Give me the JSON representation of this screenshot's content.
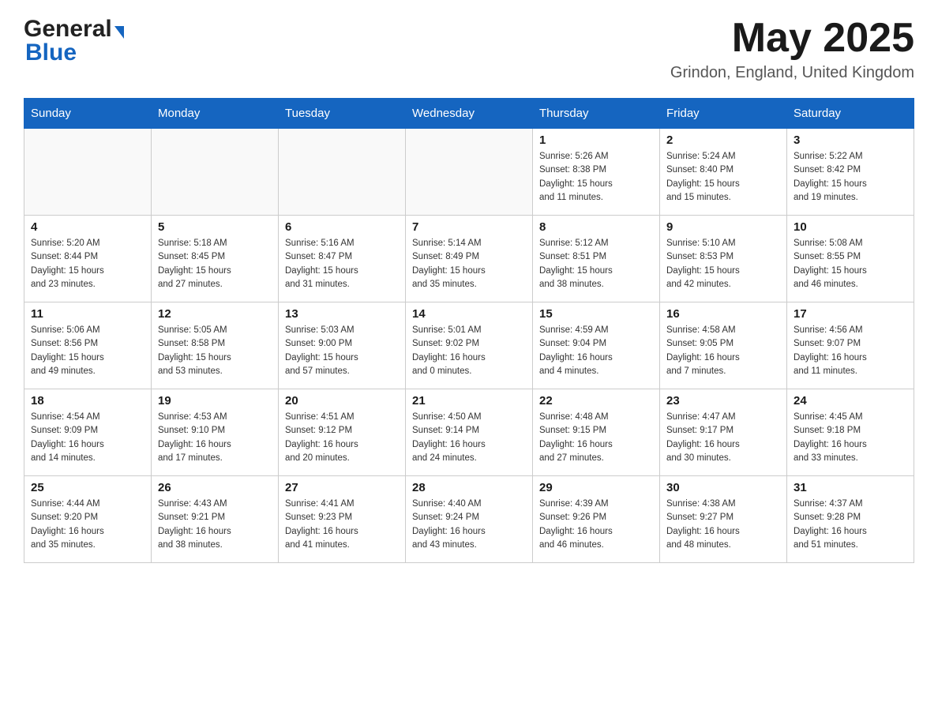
{
  "header": {
    "logo_general": "General",
    "logo_blue": "Blue",
    "month_title": "May 2025",
    "location": "Grindon, England, United Kingdom"
  },
  "days_of_week": [
    "Sunday",
    "Monday",
    "Tuesday",
    "Wednesday",
    "Thursday",
    "Friday",
    "Saturday"
  ],
  "weeks": [
    [
      {
        "day": "",
        "info": ""
      },
      {
        "day": "",
        "info": ""
      },
      {
        "day": "",
        "info": ""
      },
      {
        "day": "",
        "info": ""
      },
      {
        "day": "1",
        "info": "Sunrise: 5:26 AM\nSunset: 8:38 PM\nDaylight: 15 hours\nand 11 minutes."
      },
      {
        "day": "2",
        "info": "Sunrise: 5:24 AM\nSunset: 8:40 PM\nDaylight: 15 hours\nand 15 minutes."
      },
      {
        "day": "3",
        "info": "Sunrise: 5:22 AM\nSunset: 8:42 PM\nDaylight: 15 hours\nand 19 minutes."
      }
    ],
    [
      {
        "day": "4",
        "info": "Sunrise: 5:20 AM\nSunset: 8:44 PM\nDaylight: 15 hours\nand 23 minutes."
      },
      {
        "day": "5",
        "info": "Sunrise: 5:18 AM\nSunset: 8:45 PM\nDaylight: 15 hours\nand 27 minutes."
      },
      {
        "day": "6",
        "info": "Sunrise: 5:16 AM\nSunset: 8:47 PM\nDaylight: 15 hours\nand 31 minutes."
      },
      {
        "day": "7",
        "info": "Sunrise: 5:14 AM\nSunset: 8:49 PM\nDaylight: 15 hours\nand 35 minutes."
      },
      {
        "day": "8",
        "info": "Sunrise: 5:12 AM\nSunset: 8:51 PM\nDaylight: 15 hours\nand 38 minutes."
      },
      {
        "day": "9",
        "info": "Sunrise: 5:10 AM\nSunset: 8:53 PM\nDaylight: 15 hours\nand 42 minutes."
      },
      {
        "day": "10",
        "info": "Sunrise: 5:08 AM\nSunset: 8:55 PM\nDaylight: 15 hours\nand 46 minutes."
      }
    ],
    [
      {
        "day": "11",
        "info": "Sunrise: 5:06 AM\nSunset: 8:56 PM\nDaylight: 15 hours\nand 49 minutes."
      },
      {
        "day": "12",
        "info": "Sunrise: 5:05 AM\nSunset: 8:58 PM\nDaylight: 15 hours\nand 53 minutes."
      },
      {
        "day": "13",
        "info": "Sunrise: 5:03 AM\nSunset: 9:00 PM\nDaylight: 15 hours\nand 57 minutes."
      },
      {
        "day": "14",
        "info": "Sunrise: 5:01 AM\nSunset: 9:02 PM\nDaylight: 16 hours\nand 0 minutes."
      },
      {
        "day": "15",
        "info": "Sunrise: 4:59 AM\nSunset: 9:04 PM\nDaylight: 16 hours\nand 4 minutes."
      },
      {
        "day": "16",
        "info": "Sunrise: 4:58 AM\nSunset: 9:05 PM\nDaylight: 16 hours\nand 7 minutes."
      },
      {
        "day": "17",
        "info": "Sunrise: 4:56 AM\nSunset: 9:07 PM\nDaylight: 16 hours\nand 11 minutes."
      }
    ],
    [
      {
        "day": "18",
        "info": "Sunrise: 4:54 AM\nSunset: 9:09 PM\nDaylight: 16 hours\nand 14 minutes."
      },
      {
        "day": "19",
        "info": "Sunrise: 4:53 AM\nSunset: 9:10 PM\nDaylight: 16 hours\nand 17 minutes."
      },
      {
        "day": "20",
        "info": "Sunrise: 4:51 AM\nSunset: 9:12 PM\nDaylight: 16 hours\nand 20 minutes."
      },
      {
        "day": "21",
        "info": "Sunrise: 4:50 AM\nSunset: 9:14 PM\nDaylight: 16 hours\nand 24 minutes."
      },
      {
        "day": "22",
        "info": "Sunrise: 4:48 AM\nSunset: 9:15 PM\nDaylight: 16 hours\nand 27 minutes."
      },
      {
        "day": "23",
        "info": "Sunrise: 4:47 AM\nSunset: 9:17 PM\nDaylight: 16 hours\nand 30 minutes."
      },
      {
        "day": "24",
        "info": "Sunrise: 4:45 AM\nSunset: 9:18 PM\nDaylight: 16 hours\nand 33 minutes."
      }
    ],
    [
      {
        "day": "25",
        "info": "Sunrise: 4:44 AM\nSunset: 9:20 PM\nDaylight: 16 hours\nand 35 minutes."
      },
      {
        "day": "26",
        "info": "Sunrise: 4:43 AM\nSunset: 9:21 PM\nDaylight: 16 hours\nand 38 minutes."
      },
      {
        "day": "27",
        "info": "Sunrise: 4:41 AM\nSunset: 9:23 PM\nDaylight: 16 hours\nand 41 minutes."
      },
      {
        "day": "28",
        "info": "Sunrise: 4:40 AM\nSunset: 9:24 PM\nDaylight: 16 hours\nand 43 minutes."
      },
      {
        "day": "29",
        "info": "Sunrise: 4:39 AM\nSunset: 9:26 PM\nDaylight: 16 hours\nand 46 minutes."
      },
      {
        "day": "30",
        "info": "Sunrise: 4:38 AM\nSunset: 9:27 PM\nDaylight: 16 hours\nand 48 minutes."
      },
      {
        "day": "31",
        "info": "Sunrise: 4:37 AM\nSunset: 9:28 PM\nDaylight: 16 hours\nand 51 minutes."
      }
    ]
  ]
}
